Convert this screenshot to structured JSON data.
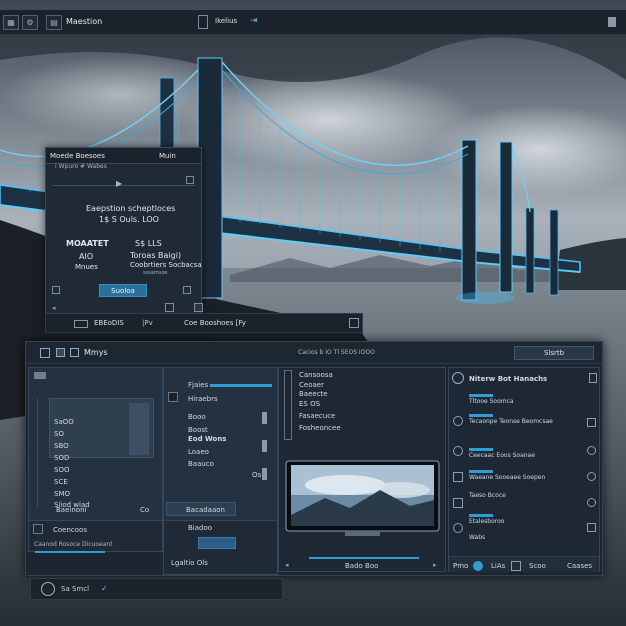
{
  "topbar": {
    "title": "Maestion",
    "tab_label": "Ikelius",
    "arrow": "⇥"
  },
  "dialog": {
    "header_left": "Moede Boesoes",
    "header_right": "Muin",
    "subheader": "i Wpuro # Wabes",
    "intro_line1": "Eaepstion scheptloces",
    "intro_line2": "1$ S Ouls. LOO",
    "label_left_1": "MOAATET",
    "label_left_2": "AIO",
    "label_left_3": "Mnues",
    "label_right_1": "S$ LLS",
    "label_right_2": "Toroas Baigi)",
    "label_right_3": "Coobrtiers Socbacsa",
    "label_right_4": "sssamsoe",
    "button": "Suoloa",
    "footer_left": "EBEoDIS",
    "footer_mid": "|Pv",
    "footer_right": "Coe Booshoes [Fy"
  },
  "window": {
    "title": "Mmys",
    "center_text": "Cacios b IO Tl  SEOS IOOO",
    "right_badge": "Slsrtb",
    "left_list": [
      "SaOO",
      "SO",
      "SBO",
      "SOD",
      "SOO",
      "SCE",
      "SMO",
      "Siiod wlad"
    ],
    "left_footer_a": "Baeinoni",
    "left_footer_b": "Co",
    "left_footer_c": "Coencoos",
    "left_footer_d": "Caanod Rosoce Dicuoeant",
    "mid_col": [
      "Hiraebrs",
      "Booo",
      "Boost",
      "Eod Wons",
      "Loaeo",
      "Baauco"
    ],
    "mid_header": "Fjaies",
    "mid_value": "Os",
    "mid_footer_a": "Bacadaaon",
    "mid_footer_b": "Biadoo",
    "mid_footer_c": "Lgaltio Ols",
    "tree_items": [
      "Cansoosa",
      "Ceoaer",
      "Baeecte",
      "ES  OS",
      "Fasaecuce",
      "Fosheoncee"
    ],
    "monitor_caption": "Bado Boo",
    "right_head": "Niterw Bot Hanachs",
    "right_items": [
      "Tltooe Soomca",
      "Tecaonpe Teonse Beomcsae",
      "Ceecaac Eoos Soanae",
      "Waeane Sooeaee Soepen",
      "Taeso Bcoce",
      "Etalesboroo",
      "Wabs"
    ],
    "right_footer_a": "Pmo",
    "right_footer_b": "LiAs",
    "right_footer_c": "Scoo",
    "right_footer_d": "Caases"
  },
  "bottombar": {
    "label": "Sa  Smcl",
    "mark": "✓"
  },
  "colors": {
    "accent": "#2f9ed8",
    "glow": "#49c1ff",
    "panel": "#243140"
  }
}
